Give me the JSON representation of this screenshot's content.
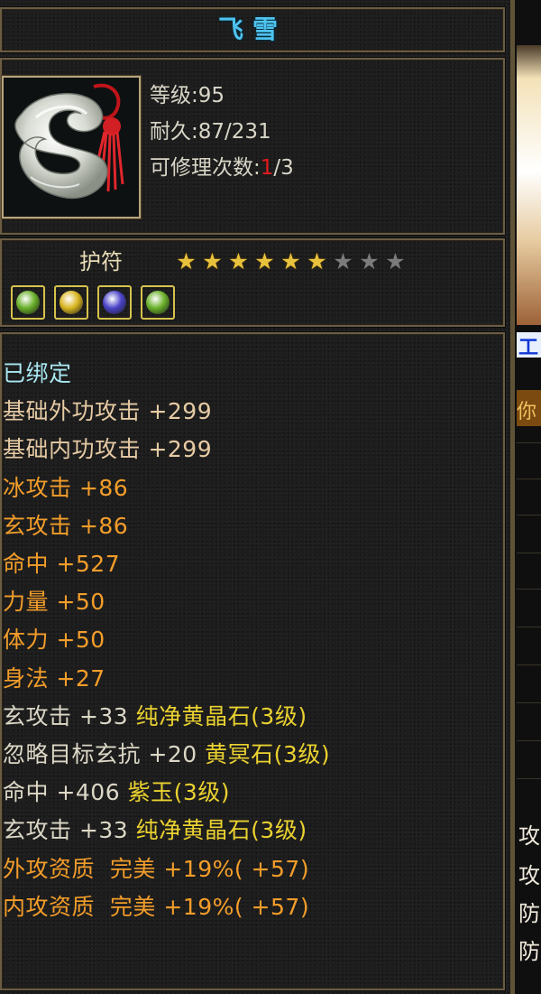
{
  "item": {
    "name": "飞雪",
    "level_label": "等级",
    "level_value": "95",
    "durability_label": "耐久",
    "durability_value": "87/231",
    "repair_label": "可修理次数",
    "repair_used": "1",
    "repair_total": "/3",
    "category": "护符",
    "stars_total": 9,
    "stars_filled": 6,
    "gems": [
      {
        "name": "green-gem",
        "color": "#6ab02a"
      },
      {
        "name": "yellow-gem",
        "color": "#d9b520"
      },
      {
        "name": "purple-gem",
        "color": "#4a44c8"
      },
      {
        "name": "green-gem",
        "color": "#6ab02a"
      }
    ]
  },
  "attributes": [
    {
      "text": "已绑定",
      "color": "cyan"
    },
    {
      "text": "基础外功攻击 +299",
      "color": "base"
    },
    {
      "text": "基础内功攻击 +299",
      "color": "base"
    },
    {
      "text": "冰攻击 +86",
      "color": "orange"
    },
    {
      "text": "玄攻击 +86",
      "color": "orange"
    },
    {
      "text": "命中 +527",
      "color": "orange"
    },
    {
      "text": "力量 +50",
      "color": "orange"
    },
    {
      "text": "体力 +50",
      "color": "orange"
    },
    {
      "text": "身法 +27",
      "color": "orange"
    }
  ],
  "gem_attributes": [
    {
      "stat": "玄攻击 +33",
      "gem": "纯净黄晶石(3级)"
    },
    {
      "stat": "忽略目标玄抗 +20",
      "gem": "黄冥石(3级)"
    },
    {
      "stat": "命中 +406",
      "gem": "紫玉(3级)"
    },
    {
      "stat": "玄攻击 +33",
      "gem": "纯净黄晶石(3级)"
    }
  ],
  "quality_attributes": [
    {
      "text": "外攻资质  完美 +19%( +57)"
    },
    {
      "text": "内攻资质  完美 +19%( +57)"
    }
  ],
  "side": {
    "blue_char": "工",
    "brick_char": "你",
    "chars": [
      "攻",
      "攻",
      "防",
      "防"
    ]
  },
  "colors": {
    "title": "#4fc3ee",
    "bound": "#a9e7f2",
    "base_attr": "#e6caa4",
    "random_attr": "#f39d2a",
    "gem_attr": "#ead130",
    "repair_used": "#e5191c",
    "star_on": "#e9c23d",
    "star_off": "#7b7b7b"
  }
}
